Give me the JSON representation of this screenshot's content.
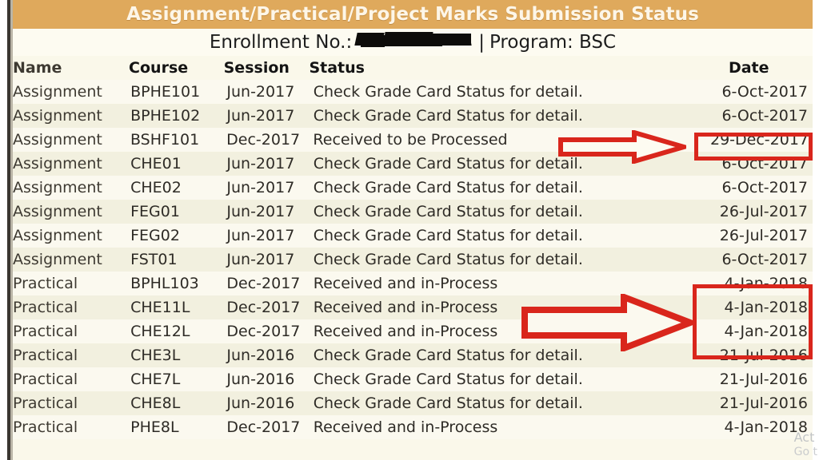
{
  "header": {
    "title": "Assignment/Practical/Project Marks Submission Status",
    "enrollment_label": "Enrollment No.:",
    "enrollment_value": "",
    "separator": "|",
    "program_label": "Program: BSC"
  },
  "colors": {
    "title_bar": "#dfa95c",
    "title_text": "#fdf6e8",
    "row_light": "#fbf9ef",
    "row_dark": "#f2f0df",
    "annotation_red": "#d9261c",
    "text": "#2e2b26"
  },
  "table": {
    "columns": [
      "Name",
      "Course",
      "Session",
      "Status",
      "Date"
    ],
    "rows": [
      {
        "name": "Assignment",
        "course": "BPHE101",
        "session": "Jun-2017",
        "status": "Check Grade Card Status for detail.",
        "date": "6-Oct-2017"
      },
      {
        "name": "Assignment",
        "course": "BPHE102",
        "session": "Jun-2017",
        "status": "Check Grade Card Status for detail.",
        "date": "6-Oct-2017"
      },
      {
        "name": "Assignment",
        "course": "BSHF101",
        "session": "Dec-2017",
        "status": "Received to be Processed",
        "date": "29-Dec-2017"
      },
      {
        "name": "Assignment",
        "course": "CHE01",
        "session": "Jun-2017",
        "status": "Check Grade Card Status for detail.",
        "date": "6-Oct-2017"
      },
      {
        "name": "Assignment",
        "course": "CHE02",
        "session": "Jun-2017",
        "status": "Check Grade Card Status for detail.",
        "date": "6-Oct-2017"
      },
      {
        "name": "Assignment",
        "course": "FEG01",
        "session": "Jun-2017",
        "status": "Check Grade Card Status for detail.",
        "date": "26-Jul-2017"
      },
      {
        "name": "Assignment",
        "course": "FEG02",
        "session": "Jun-2017",
        "status": "Check Grade Card Status for detail.",
        "date": "26-Jul-2017"
      },
      {
        "name": "Assignment",
        "course": "FST01",
        "session": "Jun-2017",
        "status": "Check Grade Card Status for detail.",
        "date": "6-Oct-2017"
      },
      {
        "name": "Practical",
        "course": "BPHL103",
        "session": "Dec-2017",
        "status": "Received and in-Process",
        "date": "4-Jan-2018"
      },
      {
        "name": "Practical",
        "course": "CHE11L",
        "session": "Dec-2017",
        "status": "Received and in-Process",
        "date": "4-Jan-2018"
      },
      {
        "name": "Practical",
        "course": "CHE12L",
        "session": "Dec-2017",
        "status": "Received and in-Process",
        "date": "4-Jan-2018"
      },
      {
        "name": "Practical",
        "course": "CHE3L",
        "session": "Jun-2016",
        "status": "Check Grade Card Status for detail.",
        "date": "21-Jul-2016"
      },
      {
        "name": "Practical",
        "course": "CHE7L",
        "session": "Jun-2016",
        "status": "Check Grade Card Status for detail.",
        "date": "21-Jul-2016"
      },
      {
        "name": "Practical",
        "course": "CHE8L",
        "session": "Jun-2016",
        "status": "Check Grade Card Status for detail.",
        "date": "21-Jul-2016"
      },
      {
        "name": "Practical",
        "course": "PHE8L",
        "session": "Dec-2017",
        "status": "Received and in-Process",
        "date": "4-Jan-2018"
      }
    ]
  },
  "annotations": {
    "arrow_1": {
      "icon": "right-arrow-icon",
      "points_to": "29-Dec-2017"
    },
    "arrow_2": {
      "icon": "right-arrow-icon",
      "points_to": "4-Jan-2018"
    },
    "highlight_1": {
      "value": "29-Dec-2017"
    },
    "highlight_2": {
      "value": "4-Jan-2018"
    }
  },
  "watermark": {
    "line1": "Act",
    "line2": "Go t"
  }
}
